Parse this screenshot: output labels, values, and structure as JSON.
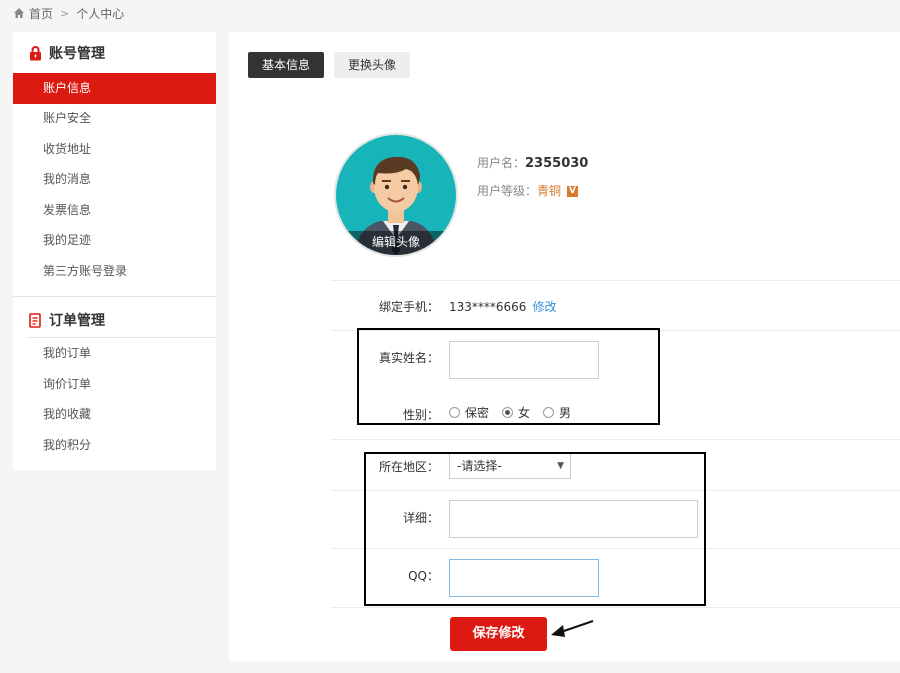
{
  "breadcrumb": {
    "home": "首页",
    "sep": ">",
    "current": "个人中心"
  },
  "sidebar": {
    "group1_title": "账号管理",
    "group1_items": [
      "账户信息",
      "账户安全",
      "收货地址",
      "我的消息",
      "发票信息",
      "我的足迹",
      "第三方账号登录"
    ],
    "group2_title": "订单管理",
    "group2_items": [
      "我的订单",
      "询价订单",
      "我的收藏",
      "我的积分"
    ]
  },
  "tabs": {
    "basic": "基本信息",
    "avatar": "更换头像"
  },
  "avatar": {
    "edit_label": "编辑头像"
  },
  "user": {
    "name_label": "用户名：",
    "name_value": "2355030",
    "level_label": "用户等级：",
    "level_value": "青铜",
    "level_badge": "V"
  },
  "form": {
    "phone_label": "绑定手机：",
    "phone_value": "133****6666",
    "phone_edit": "修改",
    "realname_label": "真实姓名：",
    "realname_value": "",
    "gender_label": "性别：",
    "gender_options": [
      "保密",
      "女",
      "男"
    ],
    "gender_selected": "女",
    "region_label": "所在地区：",
    "region_value": "-请选择-",
    "detail_label": "详细：",
    "detail_value": "",
    "qq_label": "QQ：",
    "qq_value": ""
  },
  "save_label": "保存修改",
  "colors": {
    "accent": "#dd1a12",
    "link": "#3a8fd8",
    "level": "#d97a2b"
  }
}
